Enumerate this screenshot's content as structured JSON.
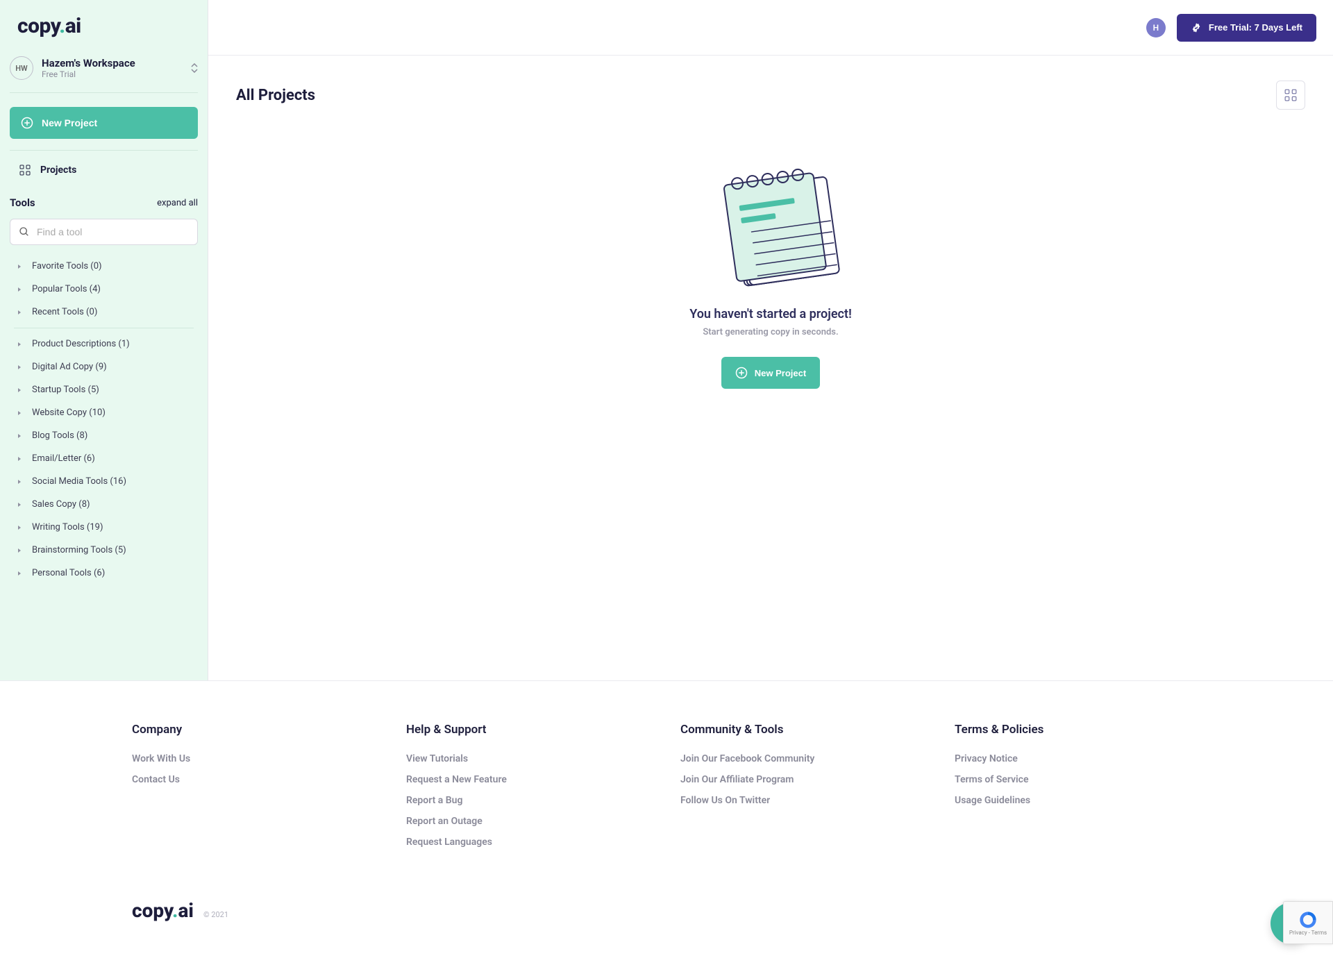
{
  "brand": {
    "name_left": "copy",
    "name_right": "ai"
  },
  "workspace": {
    "avatar": "HW",
    "name": "Hazem's Workspace",
    "plan": "Free Trial"
  },
  "sidebar": {
    "new_project": "New Project",
    "projects_label": "Projects",
    "tools_title": "Tools",
    "expand_all": "expand all",
    "search_placeholder": "Find a tool",
    "categories_a": [
      {
        "label": "Favorite Tools (0)"
      },
      {
        "label": "Popular Tools (4)"
      },
      {
        "label": "Recent Tools (0)"
      }
    ],
    "categories_b": [
      {
        "label": "Product Descriptions (1)"
      },
      {
        "label": "Digital Ad Copy (9)"
      },
      {
        "label": "Startup Tools (5)"
      },
      {
        "label": "Website Copy (10)"
      },
      {
        "label": "Blog Tools (8)"
      },
      {
        "label": "Email/Letter (6)"
      },
      {
        "label": "Social Media Tools (16)"
      },
      {
        "label": "Sales Copy (8)"
      },
      {
        "label": "Writing Tools (19)"
      },
      {
        "label": "Brainstorming Tools (5)"
      },
      {
        "label": "Personal Tools (6)"
      }
    ]
  },
  "topbar": {
    "avatar": "H",
    "trial_label": "Free Trial: 7 Days Left"
  },
  "main": {
    "title": "All Projects",
    "empty_title": "You haven't started a project!",
    "empty_sub": "Start generating copy in seconds.",
    "empty_btn": "New Project"
  },
  "footer": {
    "cols": [
      {
        "title": "Company",
        "links": [
          "Work With Us",
          "Contact Us"
        ]
      },
      {
        "title": "Help & Support",
        "links": [
          "View Tutorials",
          "Request a New Feature",
          "Report a Bug",
          "Report an Outage",
          "Request Languages"
        ]
      },
      {
        "title": "Community & Tools",
        "links": [
          "Join Our Facebook Community",
          "Join Our Affiliate Program",
          "Follow Us On Twitter"
        ]
      },
      {
        "title": "Terms & Policies",
        "links": [
          "Privacy Notice",
          "Terms of Service",
          "Usage Guidelines"
        ]
      }
    ],
    "copyright": "© 2021"
  },
  "recaptcha": "Privacy - Terms"
}
